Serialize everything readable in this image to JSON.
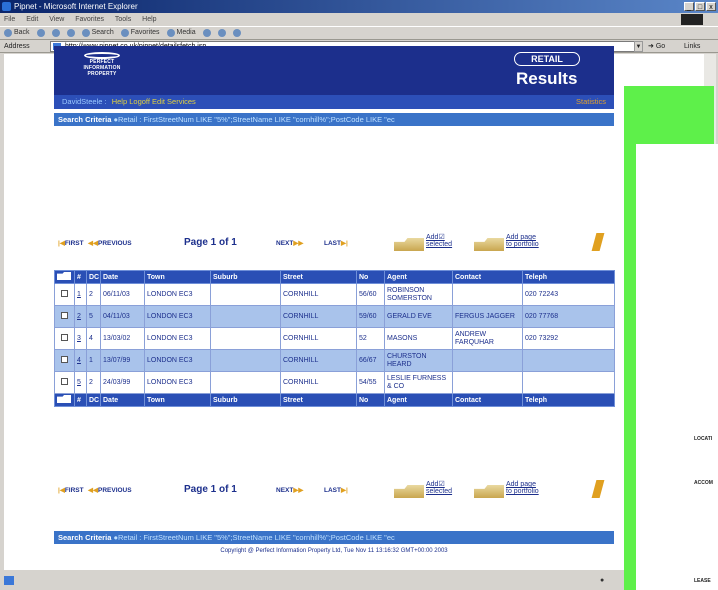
{
  "browser": {
    "title": "Pipnet - Microsoft Internet Explorer",
    "menu": [
      "File",
      "Edit",
      "View",
      "Favorites",
      "Tools",
      "Help"
    ],
    "toolbar": [
      "Back",
      "Search",
      "Favorites",
      "Media"
    ],
    "address_label": "Address",
    "address": "http://www.pipnet.co.uk/pipnet/detailsfetch.jsp",
    "go_label": "Go",
    "links_label": "Links",
    "window_buttons": [
      "_",
      "□",
      "x"
    ]
  },
  "header": {
    "logo_lines": [
      "PERFECT",
      "INFORMATION",
      "PROPERTY"
    ],
    "retail_label": "RETAIL",
    "title": "Results"
  },
  "userbar": {
    "user": "DavidSteele",
    "links": "Help Logoff Edit Services",
    "right": "Statistics"
  },
  "criteria": {
    "label": "Search Criteria",
    "text": "Retail : FirstStreetNum LIKE \"5%\";StreetName LIKE \"cornhill%\";PostCode LIKE \"ec"
  },
  "nav": {
    "first": "FIRST",
    "previous": "PREVIOUS",
    "page": "Page 1 of 1",
    "next": "NEXT",
    "last": "LAST",
    "add_selected": [
      "Add",
      "selected"
    ],
    "add_portfolio": [
      "Add page",
      "to portfolio"
    ]
  },
  "table": {
    "headers": [
      "",
      "#",
      "DC",
      "Date",
      "Town",
      "Suburb",
      "Street",
      "No",
      "Agent",
      "Contact",
      "Teleph"
    ],
    "rows": [
      {
        "num": "1",
        "dc": "2",
        "date": "06/11/03",
        "town": "LONDON EC3",
        "suburb": "",
        "street": "CORNHILL",
        "no": "56/60",
        "agent": "ROBINSON SOMERSTON",
        "contact": "",
        "tel": "020 72243"
      },
      {
        "num": "2",
        "dc": "5",
        "date": "04/11/03",
        "town": "LONDON EC3",
        "suburb": "",
        "street": "CORNHILL",
        "no": "59/60",
        "agent": "GERALD EVE",
        "contact": "FERGUS JAGGER",
        "tel": "020 77768"
      },
      {
        "num": "3",
        "dc": "4",
        "date": "13/03/02",
        "town": "LONDON EC3",
        "suburb": "",
        "street": "CORNHILL",
        "no": "52",
        "agent": "MASONS",
        "contact": "ANDREW FARQUHAR",
        "tel": "020 73292"
      },
      {
        "num": "4",
        "dc": "1",
        "date": "13/07/99",
        "town": "LONDON EC3",
        "suburb": "",
        "street": "CORNHILL",
        "no": "66/67",
        "agent": "CHURSTON HEARD",
        "contact": "",
        "tel": ""
      },
      {
        "num": "5",
        "dc": "2",
        "date": "24/03/99",
        "town": "LONDON EC3",
        "suburb": "",
        "street": "CORNHILL",
        "no": "54/55",
        "agent": "LESLIE FURNESS & CO",
        "contact": "",
        "tel": ""
      }
    ]
  },
  "copyright": "Copyright @ Perfect Information Property Ltd, Tue Nov 11 13:16:32 GMT+00:00 2003",
  "paper_labels": [
    "LOCATI",
    "ACCOM",
    "LEASE"
  ]
}
